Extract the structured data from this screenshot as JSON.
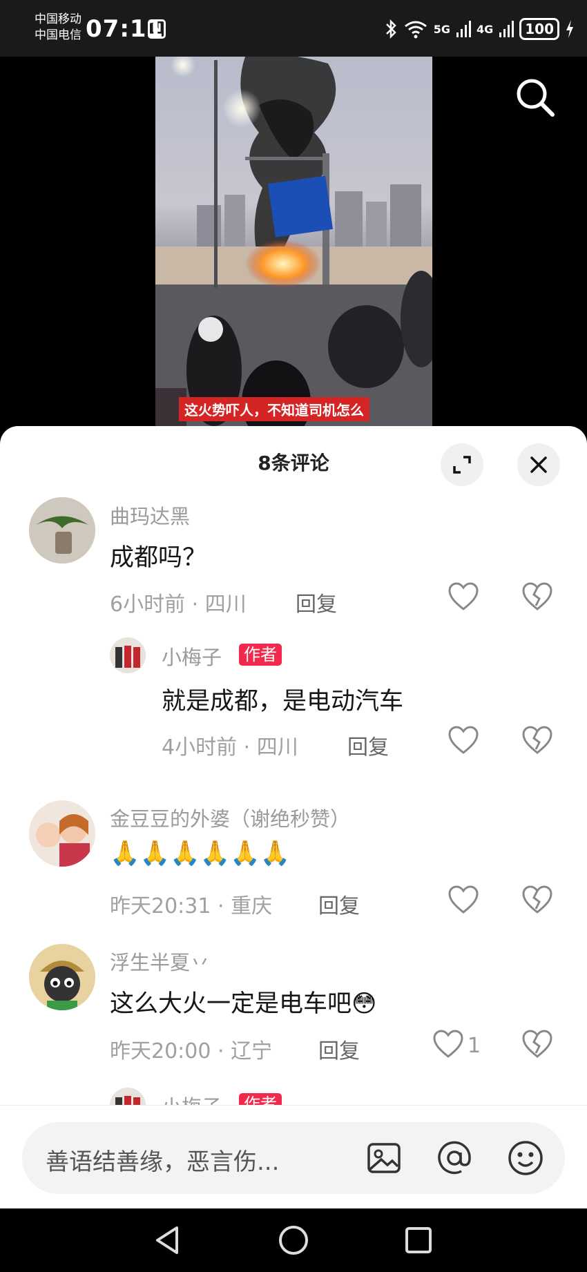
{
  "status_bar": {
    "carrier_1": "中国移动",
    "carrier_2": "中国电信",
    "time": "07:11",
    "nfc": "N",
    "network_1": "5G",
    "network_2": "4G",
    "battery": "100"
  },
  "video": {
    "caption": "这火势吓人，不知道司机怎么"
  },
  "comments": {
    "title": "8条评论",
    "items": [
      {
        "user": "曲玛达黑",
        "text": "成都吗？",
        "time": "6小时前",
        "location": "四川",
        "reply": "回复",
        "sep": "·"
      },
      {
        "user": "小梅子",
        "badge": "作者",
        "text": "就是成都，是电动汽车",
        "time": "4小时前",
        "location": "四川",
        "reply": "回复",
        "sep": "·"
      },
      {
        "user": "金豆豆的外婆（谢绝秒赞）",
        "text": "🙏🙏🙏🙏🙏🙏",
        "time": "昨天20:31",
        "location": "重庆",
        "reply": "回复",
        "sep": "·"
      },
      {
        "user": "浮生半夏丷",
        "text": "这么大火一定是电车吧😳",
        "time": "昨天20:00",
        "location": "辽宁",
        "reply": "回复",
        "likes": "1",
        "sep": "·"
      },
      {
        "user": "小梅子",
        "badge": "作者"
      }
    ]
  },
  "input": {
    "placeholder": "善语结善缘，恶言伤..."
  },
  "icons": {
    "search": "search-icon",
    "expand": "expand-icon",
    "close": "close-icon",
    "like": "heart-icon",
    "dislike": "broken-heart-icon",
    "image": "image-icon",
    "mention": "at-icon",
    "emoji": "emoji-icon"
  },
  "colors": {
    "author_badge": "#f0294d",
    "caption_bg": "#d42424"
  }
}
